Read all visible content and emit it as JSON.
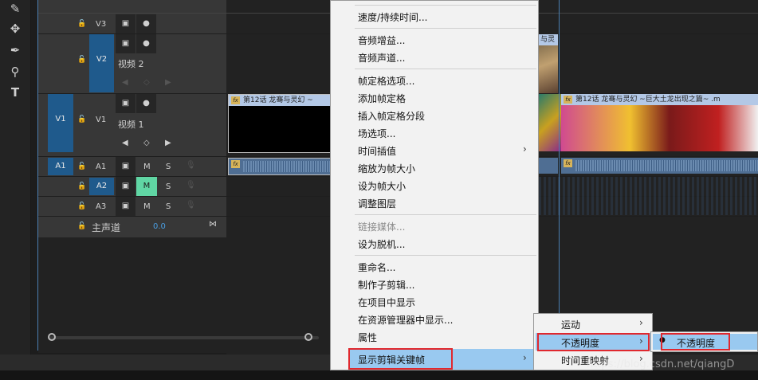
{
  "tools": [
    "pen-tool-icon",
    "move-icon",
    "pen-icon",
    "zoom-icon",
    "type-icon"
  ],
  "tracks": {
    "v3": {
      "target": "V3"
    },
    "v2": {
      "source": "V2",
      "target": "V2",
      "name": "视频 2"
    },
    "v1": {
      "source": "V1",
      "target": "V1",
      "name": "视频 1"
    },
    "a1": {
      "source": "A1",
      "target": "A1",
      "m": "M",
      "s": "S"
    },
    "a2": {
      "target": "A2",
      "m": "M",
      "s": "S"
    },
    "a3": {
      "target": "A3",
      "m": "M",
      "s": "S"
    },
    "master": {
      "label": "主声道",
      "value": "0.0"
    }
  },
  "clips": {
    "clip1_title": "第12话 龙骞与灵幻 ~",
    "clip2_title": "第12话 龙骞与灵幻 ~巨大土龙出现之篇~ .m",
    "clip_top_title": "与灵",
    "fx_label": "fx"
  },
  "context_menu": {
    "items": [
      {
        "label": "速度/持续时间..."
      },
      {
        "label": "音频增益..."
      },
      {
        "label": "音频声道..."
      },
      {
        "label": "帧定格选项..."
      },
      {
        "label": "添加帧定格"
      },
      {
        "label": "插入帧定格分段"
      },
      {
        "label": "场选项..."
      },
      {
        "label": "时间插值"
      },
      {
        "label": "缩放为帧大小"
      },
      {
        "label": "设为帧大小"
      },
      {
        "label": "调整图层"
      },
      {
        "label": "链接媒体..."
      },
      {
        "label": "设为脱机..."
      },
      {
        "label": "重命名..."
      },
      {
        "label": "制作子剪辑..."
      },
      {
        "label": "在项目中显示"
      },
      {
        "label": "在资源管理器中显示..."
      },
      {
        "label": "属性"
      },
      {
        "label": "显示剪辑关键帧"
      }
    ]
  },
  "submenu1": {
    "items": [
      {
        "label": "运动"
      },
      {
        "label": "不透明度"
      },
      {
        "label": "时间重映射"
      }
    ]
  },
  "submenu2": {
    "items": [
      {
        "label": "不透明度"
      }
    ]
  },
  "watermark": "https://blog.csdn.net/qiangD",
  "colors": {
    "accent_blue": "#1f5a8c",
    "highlight": "#99c9f0",
    "mute_active": "#60d6a4",
    "red_box": "#e0282e"
  }
}
